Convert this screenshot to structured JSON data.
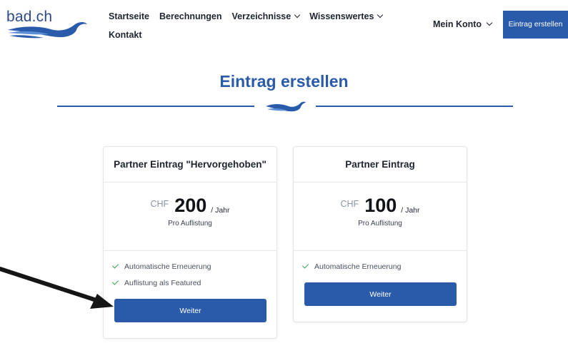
{
  "header": {
    "logo_text": "bad.ch",
    "nav": [
      {
        "label": "Startseite"
      },
      {
        "label": "Berechnungen"
      },
      {
        "label": "Verzeichnisse"
      },
      {
        "label": "Wissenswertes"
      },
      {
        "label": "Kontakt"
      }
    ],
    "account_label": "Mein Konto",
    "cta_label": "Eintrag erstellen"
  },
  "page": {
    "title": "Eintrag erstellen"
  },
  "plans": [
    {
      "title": "Partner Eintrag \"Hervorgehoben\"",
      "currency": "CHF",
      "amount": "200",
      "period": "/ Jahr",
      "sub": "Pro Auflistung",
      "features": [
        "Automatische Erneuerung",
        "Auflistung als Featured"
      ],
      "button": "Weiter"
    },
    {
      "title": "Partner Eintrag",
      "currency": "CHF",
      "amount": "100",
      "period": "/ Jahr",
      "sub": "Pro Auflistung",
      "features": [
        "Automatische Erneuerung"
      ],
      "button": "Weiter"
    }
  ],
  "colors": {
    "accent": "#2a5bab",
    "check": "#3aa655",
    "text": "#1f2430"
  }
}
